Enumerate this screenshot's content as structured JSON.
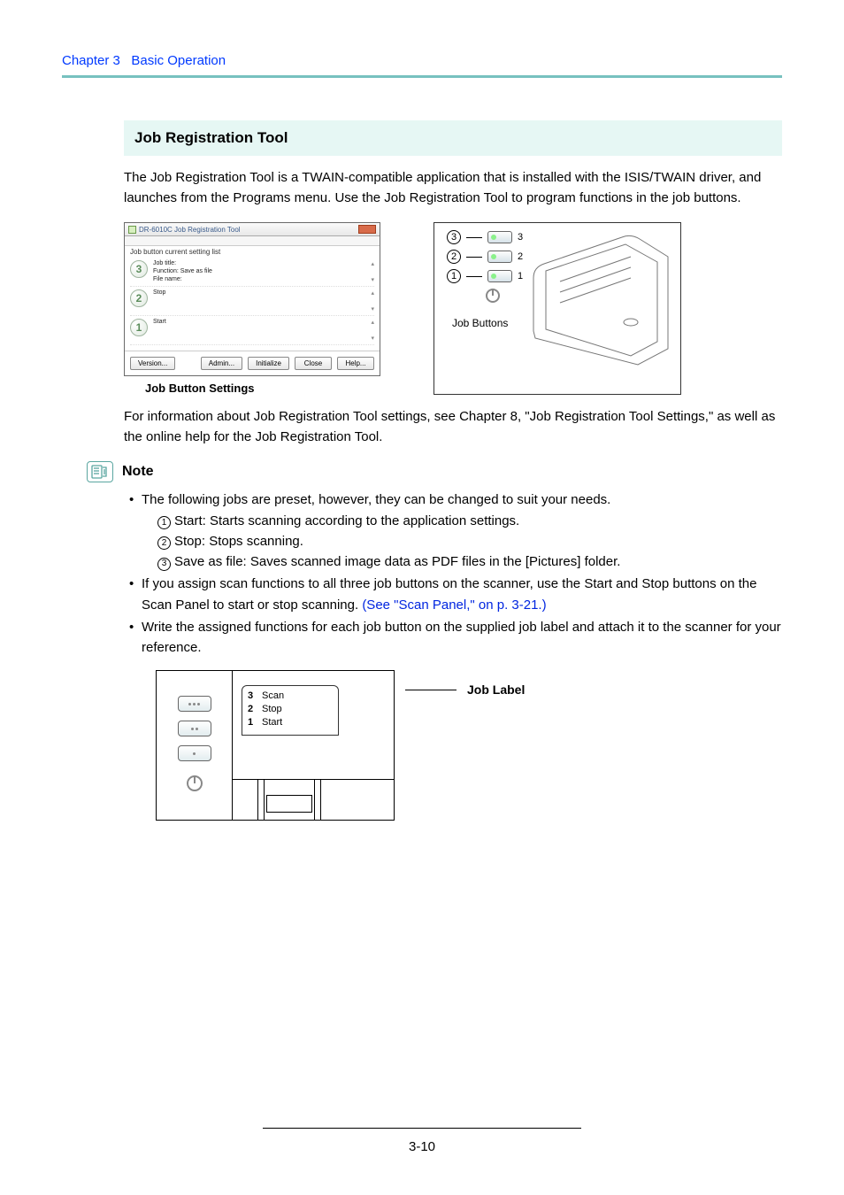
{
  "header": {
    "chapter": "Chapter 3",
    "title": "Basic Operation"
  },
  "section": {
    "title": "Job Registration Tool"
  },
  "intro": "The Job Registration Tool is a TWAIN-compatible application that is installed with the ISIS/TWAIN driver, and launches from the Programs menu. Use the Job Registration Tool to program functions in the job buttons.",
  "jobtool": {
    "window_title": "DR-6010C Job Registration Tool",
    "list_label": "Job button current setting list",
    "rows": [
      {
        "num": "3",
        "title": "Job title:",
        "func": "Function: Save as file",
        "file": "File name:"
      },
      {
        "num": "2",
        "title": "Stop"
      },
      {
        "num": "1",
        "title": "Start"
      }
    ],
    "buttons": {
      "version": "Version...",
      "admin": "Admin...",
      "initialize": "Initialize",
      "close": "Close",
      "help": "Help..."
    },
    "caption": "Job Button Settings"
  },
  "scanner_fig": {
    "callouts": [
      {
        "num": "3",
        "key": "3"
      },
      {
        "num": "2",
        "key": "2"
      },
      {
        "num": "1",
        "key": "1"
      }
    ],
    "label": "Job Buttons"
  },
  "para2_a": "For information about Job Registration Tool settings, see Chapter 8, \"Job Registration Tool Settings,\" as well as the online help for the Job Registration Tool.",
  "note": {
    "title": "Note",
    "items": [
      {
        "text": "The following jobs are preset, however, they can be changed to suit your needs.",
        "sub": [
          {
            "n": "1",
            "t": "Start: Starts scanning according to the application settings."
          },
          {
            "n": "2",
            "t": "Stop: Stops scanning."
          },
          {
            "n": "3",
            "t": "Save as file: Saves scanned image data as PDF files in the [Pictures] folder."
          }
        ]
      },
      {
        "text_a": "If you assign scan functions to all three job buttons on the scanner, use the Start and Stop buttons on the Scan Panel to start or stop scanning. ",
        "link": "(See \"Scan Panel,\" on p. 3-21.)"
      },
      {
        "text": "Write the assigned functions for each job button on the supplied job label and attach it to the scanner for your reference."
      }
    ]
  },
  "joblabel": {
    "rows": [
      {
        "n": "3",
        "t": "Scan"
      },
      {
        "n": "2",
        "t": "Stop"
      },
      {
        "n": "1",
        "t": "Start"
      }
    ],
    "callout": "Job Label"
  },
  "footer": {
    "page": "3-10"
  }
}
